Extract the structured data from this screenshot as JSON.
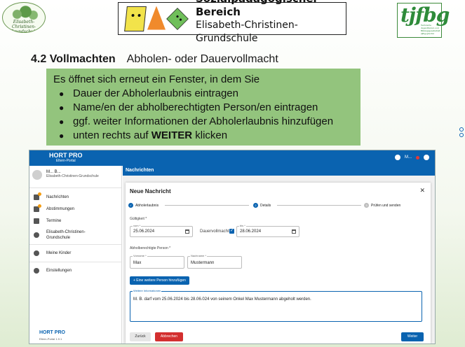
{
  "header": {
    "school_logo_text": "Elisabeth-Christinen-Grundschule",
    "banner_title": "Sozialpädagogischer Bereich",
    "banner_subtitle": "Elisabeth-Christinen-Grundschule",
    "right_logo_text": "tjfbg",
    "right_logo_small": "Technische Jugendfreizeit- und Bildungsgesellschaft (tjfbg) gGmbH"
  },
  "slide": {
    "section": "4.2 Vollmachten",
    "section_sub": "Abholen- oder Dauervollmacht",
    "intro": "Es öffnet sich erneut ein Fenster, in dem Sie",
    "bullets": [
      "Dauer der Abholerlaubnis eintragen",
      "Name/en der abholberechtigten Person/en eintragen",
      "ggf. weiter Informationen der Abholerlaubnis hinzufügen"
    ],
    "last_bullet_pre": "unten rechts auf ",
    "last_bullet_bold": "WEITER",
    "last_bullet_post": " klicken"
  },
  "app": {
    "brand": "HORT PRO",
    "brand_sub": "Eltern-Portal",
    "user_short": "M...",
    "profile": {
      "name": "M... B...",
      "school": "Elisabeth-Christinen-Grundschule"
    },
    "nav": [
      {
        "label": "Nachrichten",
        "icon": "mail-icon"
      },
      {
        "label": "Abstimmungen",
        "icon": "poll-icon"
      },
      {
        "label": "Termine",
        "icon": "calendar-icon"
      },
      {
        "label": "Elisabeth-Christinen-Grundschule",
        "icon": "info-icon"
      },
      {
        "label": "Meine Kinder",
        "icon": "people-icon"
      },
      {
        "label": "Einstellungen",
        "icon": "gear-icon"
      }
    ],
    "footer_brand": "HORT PRO",
    "footer_version": "Eltern-Portal 1.9.1",
    "page_title": "Nachrichten",
    "dialog": {
      "title": "Neue Nachricht",
      "steps": [
        "Abholerlaubnis",
        "Details",
        "Prüfen und senden"
      ],
      "validity_label": "Gültigkeit *",
      "from_label": "vom *",
      "from_value": "25.06.2024",
      "permanent_label": "Dauervollmacht",
      "permanent_checked": true,
      "to_label": "bis *",
      "to_value": "28.06.2024",
      "person_label": "Abholberechtigte Person *",
      "firstname_label": "Vorname *",
      "firstname_value": "Max",
      "lastname_label": "Nachname *",
      "lastname_value": "Mustermann",
      "add_person_label": "+ Eine weitere Person hinzufügen",
      "info_label": "Weitere Informationen",
      "info_value": "M. B. darf vom 25.06.2024 bis 28.06.024 von seinem Onkel Max Mustermann abgeholt werden.",
      "back_label": "Zurück",
      "cancel_label": "Abbrechen",
      "next_label": "Weiter"
    }
  }
}
